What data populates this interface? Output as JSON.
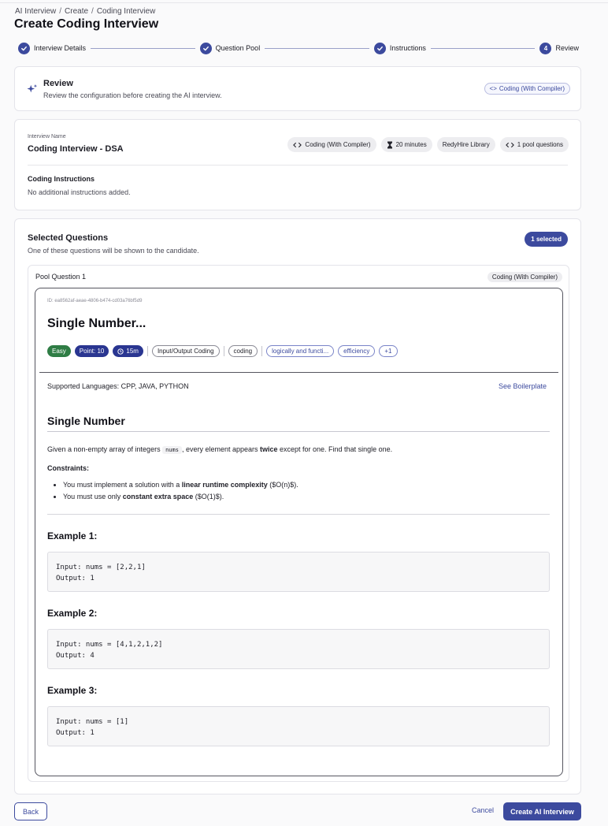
{
  "breadcrumb": [
    "AI Interview",
    "Create",
    "Coding Interview"
  ],
  "page_title": "Create Coding Interview",
  "steps": [
    {
      "label": "Interview Details",
      "state": "done"
    },
    {
      "label": "Question Pool",
      "state": "done"
    },
    {
      "label": "Instructions",
      "state": "done"
    },
    {
      "label": "Review",
      "state": "current",
      "number": "4"
    }
  ],
  "review": {
    "title": "Review",
    "subtitle": "Review the configuration before creating the AI interview.",
    "type_chip": "Coding (With Compiler)"
  },
  "interview": {
    "name_label": "Interview Name",
    "name": "Coding Interview - DSA",
    "chips": {
      "type": "Coding (With Compiler)",
      "duration": "20 minutes",
      "library": "RedyHire Library",
      "pool": "1 pool questions"
    },
    "instructions_title": "Coding Instructions",
    "instructions_text": "No additional instructions added."
  },
  "selected": {
    "title": "Selected Questions",
    "subtitle": "One of these questions will be shown to the candidate.",
    "badge": "1 selected"
  },
  "pool": {
    "title": "Pool Question 1",
    "type_chip": "Coding (With Compiler)",
    "question": {
      "id": "ID: ea8562af-aeae-4806-b474-cd03a76bf5d9",
      "title": "Single Number...",
      "tags": {
        "difficulty": "Easy",
        "points": "Point: 10",
        "time": "15m",
        "t1": "Input/Output Coding",
        "t2": "coding",
        "t3": "logically and functi...",
        "t4": "efficiency",
        "more": "+1"
      },
      "languages": "Supported Languages: CPP, JAVA, PYTHON",
      "boilerplate_link": "See Boilerplate",
      "heading": "Single Number",
      "desc_pre": "Given a non-empty array of integers ",
      "desc_code": "nums",
      "desc_mid": ", every element appears ",
      "desc_bold": "twice",
      "desc_post": " except for one. Find that single one.",
      "constraints_title": "Constraints:",
      "c1_pre": "You must implement a solution with a ",
      "c1_bold": "linear runtime complexity",
      "c1_post": " ($O(n)$).",
      "c2_pre": "You must use only ",
      "c2_bold": "constant extra space",
      "c2_post": " ($O(1)$).",
      "examples": [
        {
          "title": "Example 1:",
          "input": "Input: nums = [2,2,1]",
          "output": "Output: 1"
        },
        {
          "title": "Example 2:",
          "input": "Input: nums = [4,1,2,1,2]",
          "output": "Output: 4"
        },
        {
          "title": "Example 3:",
          "input": "Input: nums = [1]",
          "output": "Output: 1"
        }
      ]
    }
  },
  "footer": {
    "back": "Back",
    "cancel": "Cancel",
    "create": "Create AI Interview"
  },
  "colors": {
    "accent": "#3c4a9e",
    "easy": "#2f7d45"
  }
}
